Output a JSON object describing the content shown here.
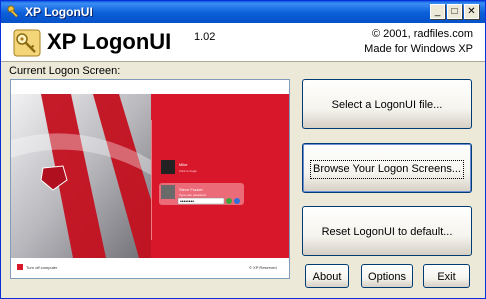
{
  "window": {
    "title": "XP LogonUI"
  },
  "header": {
    "app_name": "XP LogonUI",
    "version": "1.02",
    "copyright": "© 2001, radfiles.com",
    "made_for": "Made for Windows XP"
  },
  "current_label": "Current Logon Screen:",
  "preview": {
    "user_name_1": "Mike",
    "user_sub_1": "Click to begin",
    "user_name_2": "Steve Frazier",
    "user_sub_2": "Type your password",
    "password_mask": "••••••••",
    "turn_off": "Turn off computer",
    "footer_right": "© XP Reserved",
    "colors": {
      "red": "#d9172b",
      "dark_red": "#b00f1f",
      "white": "#ffffff"
    }
  },
  "buttons": {
    "select": "Select a LogonUI file...",
    "browse": "Browse Your Logon Screens...",
    "reset": "Reset LogonUI to default...",
    "about": "About",
    "options": "Options",
    "exit": "Exit"
  },
  "icons": {
    "app": "key-icon",
    "minimize": "minimize-icon",
    "maximize": "maximize-icon",
    "close": "close-icon"
  }
}
